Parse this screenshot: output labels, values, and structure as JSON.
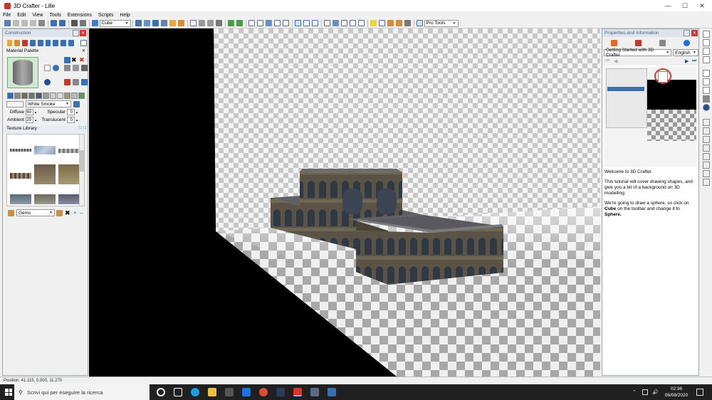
{
  "window": {
    "title": "3D Crafter - Lille"
  },
  "menu": [
    "File",
    "Edit",
    "View",
    "Tools",
    "Extensions",
    "Scripts",
    "Help"
  ],
  "toolbar": {
    "shape_select": "Cube",
    "pro_tools": "Pro Tools"
  },
  "construction": {
    "title": "Construction",
    "material_palette": "Material Palette",
    "material_name": "White Smoke",
    "diffuse_label": "Diffuse",
    "diffuse_value": "60",
    "specular_label": "Specular",
    "specular_value": "0",
    "ambient_label": "Ambient",
    "ambient_value": "20",
    "translucent_label": "Translucent",
    "translucent_value": "0",
    "texture_library": "Texture Library",
    "texture_category": "Gems"
  },
  "properties": {
    "title": "Properties and Information",
    "tutorial_select": "Getting Started with 3D Crafter",
    "language_select": "English",
    "tutorial_p1": "Welcome to 3D Crafter.",
    "tutorial_p2": "This tutorial will cover drawing shapes, and give you a bit of a background on 3D modelling.",
    "tutorial_p3_pre": "We're going to draw a sphere, so click on",
    "tutorial_p3_b1": "Cube",
    "tutorial_p3_mid": "on the toolbar and change it to",
    "tutorial_p3_b2": "Sphere."
  },
  "status": {
    "position": "Position: 41.115, 0.000, 11.270"
  },
  "taskbar": {
    "search_placeholder": "Scrivi qui per eseguire la ricerca",
    "time": "02:36",
    "date": "06/08/2020"
  },
  "colors": {
    "accent": "#0078d7",
    "panel_header": "#dde4ee",
    "close_red": "#d9342b"
  }
}
